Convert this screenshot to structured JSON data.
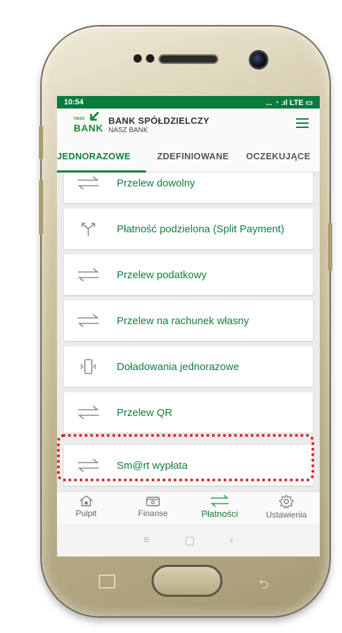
{
  "status_bar": {
    "time": "10:54",
    "indicators": "... ◔ .ıl LTE ▭"
  },
  "header": {
    "logo_top": "nasz",
    "logo_bottom": "BANK",
    "bank_name": "BANK SPÓŁDZIELCZY",
    "bank_subname": "NASZ BANK",
    "menu_icon": "hamburger-menu-icon",
    "brand_color": "#137d3c"
  },
  "tabs": [
    {
      "label": "JEDNORAZOWE",
      "active": true
    },
    {
      "label": "ZDEFINIOWANE",
      "active": false
    },
    {
      "label": "OCZEKUJĄCE",
      "active": false
    }
  ],
  "transfers": [
    {
      "label": "Przelew dowolny",
      "icon": "transfer-arrows-icon"
    },
    {
      "label": "Płatność podzielona (Split Payment)",
      "icon": "split-arrows-icon"
    },
    {
      "label": "Przelew podatkowy",
      "icon": "transfer-arrows-icon"
    },
    {
      "label": "Przelew na rachunek własny",
      "icon": "transfer-arrows-icon"
    },
    {
      "label": "Doładowania jednorazowe",
      "icon": "mobile-phone-icon"
    },
    {
      "label": "Przelew QR",
      "icon": "transfer-arrows-icon"
    },
    {
      "label": "Sm@rt wypłata",
      "icon": "transfer-arrows-icon",
      "highlighted": true
    }
  ],
  "bottom_nav": [
    {
      "label": "Pulpit",
      "icon": "home-icon",
      "active": false
    },
    {
      "label": "Finanse",
      "icon": "wallet-icon",
      "active": false
    },
    {
      "label": "Płatności",
      "icon": "transfer-arrows-icon",
      "active": true
    },
    {
      "label": "Ustawienia",
      "icon": "gear-icon",
      "active": false
    }
  ],
  "android_nav": {
    "recents": "≡",
    "home": "▢",
    "back": "‹"
  },
  "highlight_color": "#e01818"
}
